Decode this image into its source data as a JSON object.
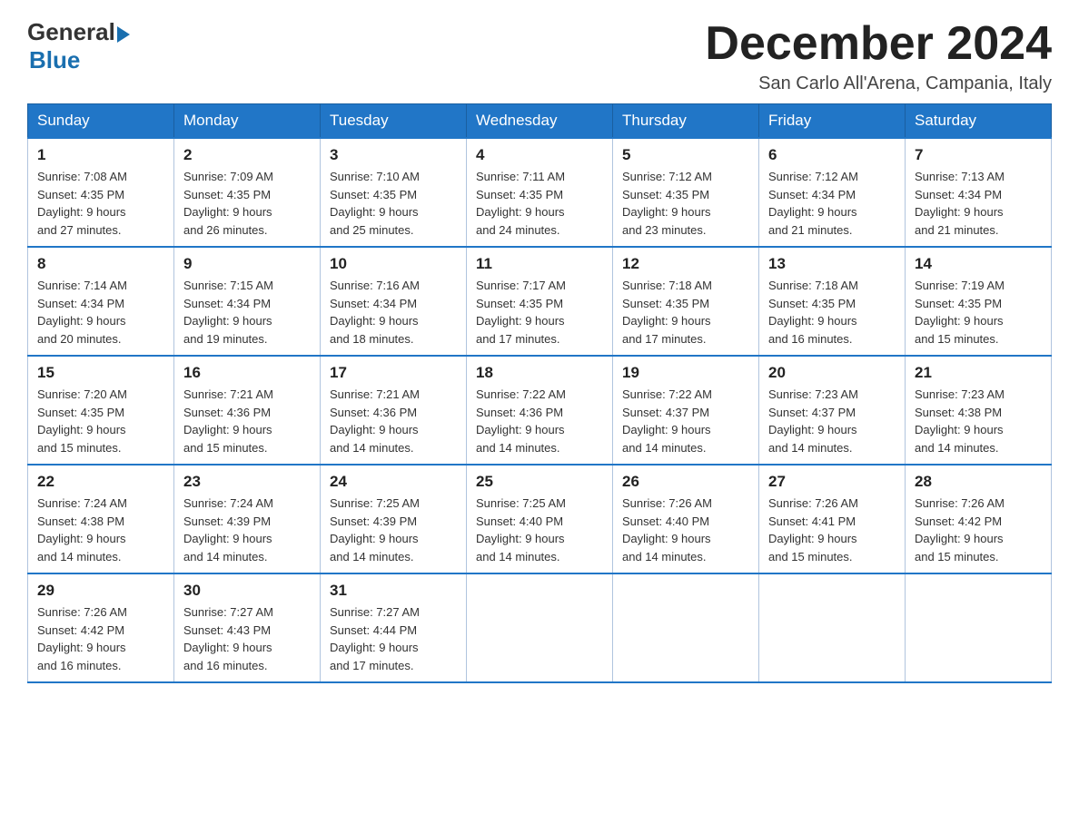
{
  "header": {
    "logo_general": "General",
    "logo_blue": "Blue",
    "month_title": "December 2024",
    "subtitle": "San Carlo All'Arena, Campania, Italy"
  },
  "weekdays": [
    "Sunday",
    "Monday",
    "Tuesday",
    "Wednesday",
    "Thursday",
    "Friday",
    "Saturday"
  ],
  "weeks": [
    [
      {
        "day": "1",
        "sunrise": "7:08 AM",
        "sunset": "4:35 PM",
        "daylight": "9 hours and 27 minutes."
      },
      {
        "day": "2",
        "sunrise": "7:09 AM",
        "sunset": "4:35 PM",
        "daylight": "9 hours and 26 minutes."
      },
      {
        "day": "3",
        "sunrise": "7:10 AM",
        "sunset": "4:35 PM",
        "daylight": "9 hours and 25 minutes."
      },
      {
        "day": "4",
        "sunrise": "7:11 AM",
        "sunset": "4:35 PM",
        "daylight": "9 hours and 24 minutes."
      },
      {
        "day": "5",
        "sunrise": "7:12 AM",
        "sunset": "4:35 PM",
        "daylight": "9 hours and 23 minutes."
      },
      {
        "day": "6",
        "sunrise": "7:12 AM",
        "sunset": "4:34 PM",
        "daylight": "9 hours and 21 minutes."
      },
      {
        "day": "7",
        "sunrise": "7:13 AM",
        "sunset": "4:34 PM",
        "daylight": "9 hours and 21 minutes."
      }
    ],
    [
      {
        "day": "8",
        "sunrise": "7:14 AM",
        "sunset": "4:34 PM",
        "daylight": "9 hours and 20 minutes."
      },
      {
        "day": "9",
        "sunrise": "7:15 AM",
        "sunset": "4:34 PM",
        "daylight": "9 hours and 19 minutes."
      },
      {
        "day": "10",
        "sunrise": "7:16 AM",
        "sunset": "4:34 PM",
        "daylight": "9 hours and 18 minutes."
      },
      {
        "day": "11",
        "sunrise": "7:17 AM",
        "sunset": "4:35 PM",
        "daylight": "9 hours and 17 minutes."
      },
      {
        "day": "12",
        "sunrise": "7:18 AM",
        "sunset": "4:35 PM",
        "daylight": "9 hours and 17 minutes."
      },
      {
        "day": "13",
        "sunrise": "7:18 AM",
        "sunset": "4:35 PM",
        "daylight": "9 hours and 16 minutes."
      },
      {
        "day": "14",
        "sunrise": "7:19 AM",
        "sunset": "4:35 PM",
        "daylight": "9 hours and 15 minutes."
      }
    ],
    [
      {
        "day": "15",
        "sunrise": "7:20 AM",
        "sunset": "4:35 PM",
        "daylight": "9 hours and 15 minutes."
      },
      {
        "day": "16",
        "sunrise": "7:21 AM",
        "sunset": "4:36 PM",
        "daylight": "9 hours and 15 minutes."
      },
      {
        "day": "17",
        "sunrise": "7:21 AM",
        "sunset": "4:36 PM",
        "daylight": "9 hours and 14 minutes."
      },
      {
        "day": "18",
        "sunrise": "7:22 AM",
        "sunset": "4:36 PM",
        "daylight": "9 hours and 14 minutes."
      },
      {
        "day": "19",
        "sunrise": "7:22 AM",
        "sunset": "4:37 PM",
        "daylight": "9 hours and 14 minutes."
      },
      {
        "day": "20",
        "sunrise": "7:23 AM",
        "sunset": "4:37 PM",
        "daylight": "9 hours and 14 minutes."
      },
      {
        "day": "21",
        "sunrise": "7:23 AM",
        "sunset": "4:38 PM",
        "daylight": "9 hours and 14 minutes."
      }
    ],
    [
      {
        "day": "22",
        "sunrise": "7:24 AM",
        "sunset": "4:38 PM",
        "daylight": "9 hours and 14 minutes."
      },
      {
        "day": "23",
        "sunrise": "7:24 AM",
        "sunset": "4:39 PM",
        "daylight": "9 hours and 14 minutes."
      },
      {
        "day": "24",
        "sunrise": "7:25 AM",
        "sunset": "4:39 PM",
        "daylight": "9 hours and 14 minutes."
      },
      {
        "day": "25",
        "sunrise": "7:25 AM",
        "sunset": "4:40 PM",
        "daylight": "9 hours and 14 minutes."
      },
      {
        "day": "26",
        "sunrise": "7:26 AM",
        "sunset": "4:40 PM",
        "daylight": "9 hours and 14 minutes."
      },
      {
        "day": "27",
        "sunrise": "7:26 AM",
        "sunset": "4:41 PM",
        "daylight": "9 hours and 15 minutes."
      },
      {
        "day": "28",
        "sunrise": "7:26 AM",
        "sunset": "4:42 PM",
        "daylight": "9 hours and 15 minutes."
      }
    ],
    [
      {
        "day": "29",
        "sunrise": "7:26 AM",
        "sunset": "4:42 PM",
        "daylight": "9 hours and 16 minutes."
      },
      {
        "day": "30",
        "sunrise": "7:27 AM",
        "sunset": "4:43 PM",
        "daylight": "9 hours and 16 minutes."
      },
      {
        "day": "31",
        "sunrise": "7:27 AM",
        "sunset": "4:44 PM",
        "daylight": "9 hours and 17 minutes."
      },
      null,
      null,
      null,
      null
    ]
  ],
  "labels": {
    "sunrise": "Sunrise:",
    "sunset": "Sunset:",
    "daylight": "Daylight:"
  }
}
